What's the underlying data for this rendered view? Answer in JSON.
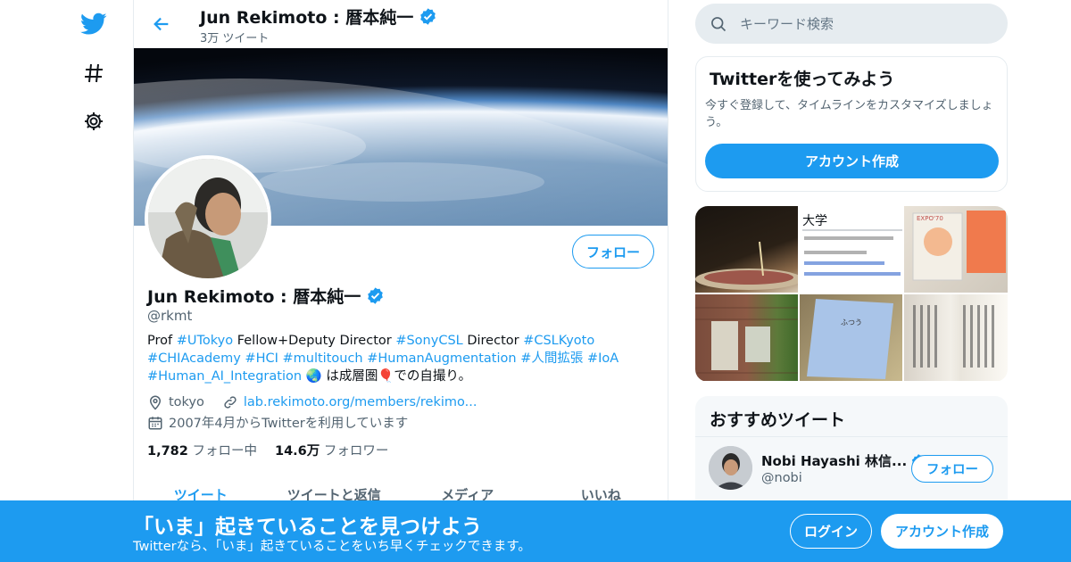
{
  "header": {
    "name": "Jun Rekimoto : 暦本純一",
    "tweet_count": "3万 ツイート"
  },
  "profile": {
    "name": "Jun Rekimoto : 暦本純一",
    "handle": "@rkmt",
    "follow_label": "フォロー",
    "bio": {
      "t1": "Prof ",
      "h1": "#UTokyo",
      "t2": " Fellow+Deputy Director ",
      "h2": "#SonyCSL",
      "t3": " Director ",
      "h3": "#CSLKyoto",
      "t4": " ",
      "h4": "#CHIAcademy",
      "t5": " ",
      "h5": "#HCI",
      "t6": " ",
      "h6": "#multitouch",
      "t7": " ",
      "h7": "#HumanAugmentation",
      "t8": " ",
      "h8": "#人間拡張",
      "t9": " ",
      "h9": "#IoA",
      "t10": " ",
      "h10": "#Human_AI_Integration",
      "t11": " 🌏 は成層圏",
      "t12": "🎈",
      "t13": "での自撮り。"
    },
    "location": "tokyo",
    "url": "lab.rekimoto.org/members/rekimo...",
    "joined": "2007年4月からTwitterを利用しています",
    "following_count": "1,782",
    "following_label": "フォロー中",
    "followers_count": "14.6万",
    "followers_label": "フォロワー"
  },
  "tabs": [
    "ツイート",
    "ツイートと返信",
    "メディア",
    "いいね"
  ],
  "search": {
    "placeholder": "キーワード検索"
  },
  "signup_card": {
    "title": "Twitterを使ってみよう",
    "text": "今すぐ登録して、タイムラインをカスタマイズしましょう。",
    "button": "アカウント作成"
  },
  "media_thumbs": [
    {
      "name": "incense-photo",
      "text": ""
    },
    {
      "name": "wikipedia-screenshot",
      "text": "大学"
    },
    {
      "name": "expo-card-photo",
      "text": "EXPO'70"
    },
    {
      "name": "brick-wall-photo",
      "text": ""
    },
    {
      "name": "blue-booklet-photo",
      "text": "ふつう"
    },
    {
      "name": "book-pages-photo",
      "text": ""
    }
  ],
  "recommended": {
    "title": "おすすめツイート",
    "name": "Nobi Hayashi 林信...",
    "handle": "@nobi",
    "follow_label": "フォロー"
  },
  "bottom_banner": {
    "headline": "「いま」起きていることを見つけよう",
    "subtext": "Twitterなら、「いま」起きていることをいち早くチェックできます。",
    "login": "ログイン",
    "signup": "アカウント作成"
  },
  "colors": {
    "accent": "#1d9bf0",
    "banner_bg": "#1d9bf0"
  }
}
